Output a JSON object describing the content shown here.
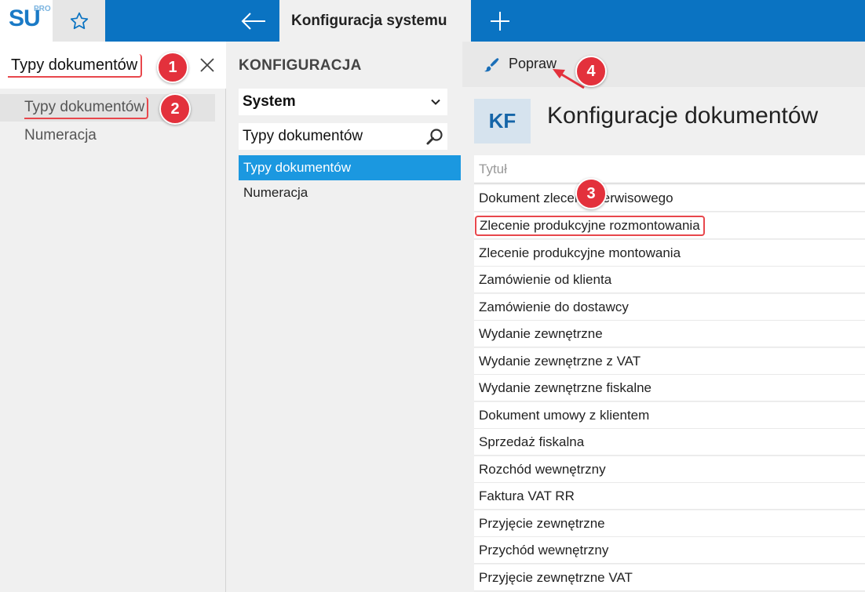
{
  "app": {
    "logo_text": "SU",
    "logo_sup": "PRO",
    "active_tab": "Konfiguracja systemu",
    "icons": {
      "star": "star-icon",
      "back": "arrow-left-icon",
      "plus": "plus-icon"
    }
  },
  "left": {
    "search_value": "Typy dokumentów",
    "items": [
      {
        "label": "Typy dokumentów"
      },
      {
        "label": "Numeracja"
      }
    ]
  },
  "middle": {
    "heading": "KONFIGURACJA",
    "select_value": "System",
    "filter_value": "Typy dokumentów",
    "items": [
      {
        "label": "Typy dokumentów"
      },
      {
        "label": "Numeracja"
      }
    ]
  },
  "right": {
    "toolbar_label": "Popraw",
    "tile_text": "KF",
    "title": "Konfiguracje dokumentów",
    "column_header": "Tytuł",
    "rows": [
      "Dokument zlecenia serwisowego",
      "Zlecenie produkcyjne rozmontowania",
      "Zlecenie produkcyjne montowania",
      "Zamówienie od klienta",
      "Zamówienie do dostawcy",
      "Wydanie zewnętrzne",
      "Wydanie zewnętrzne z VAT",
      "Wydanie zewnętrzne fiskalne",
      "Dokument umowy z klientem",
      "Sprzedaż fiskalna",
      "Rozchód wewnętrzny",
      "Faktura VAT RR",
      "Przyjęcie zewnętrzne",
      "Przychód wewnętrzny",
      "Przyjęcie zewnętrzne VAT"
    ]
  },
  "callouts": [
    "1",
    "2",
    "3",
    "4"
  ],
  "colors": {
    "brand": "#0a73c2",
    "selection": "#1b98e0",
    "callout": "#e3313c"
  }
}
